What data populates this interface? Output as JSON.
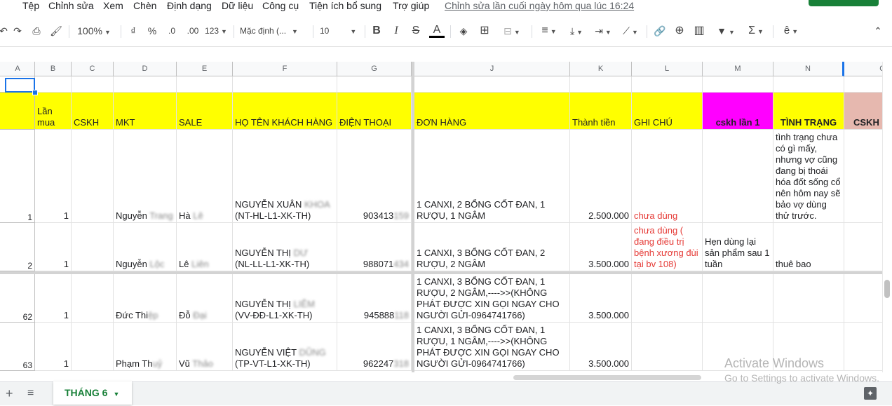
{
  "menu": {
    "items": [
      "Tệp",
      "Chỉnh sửa",
      "Xem",
      "Chèn",
      "Định dạng",
      "Dữ liệu",
      "Công cụ",
      "Tiện ích bổ sung",
      "Trợ giúp"
    ],
    "last_edit": "Chỉnh sửa lần cuối ngày hôm qua lúc 16:24"
  },
  "toolbar": {
    "zoom": "100%",
    "currency": "₫",
    "percent": "%",
    "dec_less": ".0",
    "dec_more": ".00",
    "format_more": "123",
    "font": "Mặc định (...",
    "font_size": "10",
    "bold": "B",
    "italic": "I",
    "strike": "S",
    "text_color": "A"
  },
  "grid": {
    "columns": [
      "A",
      "B",
      "C",
      "D",
      "E",
      "F",
      "G",
      "J",
      "K",
      "L",
      "M",
      "N",
      "O"
    ],
    "header_row": {
      "lan_mua": "Lần mua",
      "cskh": "CSKH",
      "mkt": "MKT",
      "sale": "SALE",
      "ho_ten": "HỌ TÊN KHÁCH HÀNG",
      "dien_thoai": "ĐIỆN THOẠI",
      "don_hang": "ĐƠN HÀNG",
      "thanh_tien": "Thành tiền",
      "ghi_chu": "GHI CHÚ",
      "cskh_lan1": "cskh lần 1",
      "tinh_trang": "TÌNH TRẠNG",
      "cskh2": "CSKH"
    },
    "rows": [
      {
        "a": "1",
        "b": "1",
        "mkt_visible": "Nguyễn",
        "mkt_hidden": "Trang",
        "sale_visible": "Hà",
        "sale_hidden": "Lê",
        "name_visible": "NGUYỄN XUÂN",
        "name_hidden": "KHOA",
        "code": "(NT-HL-L1-XK-TH)",
        "phone_visible": "903413",
        "phone_hidden": "159",
        "order": "1 CANXI, 2 BỔNG CỐT ĐAN, 1\nRƯỢU, 1 NGÂM",
        "amount": "2.500.000",
        "note": "chưa dùng",
        "cskh1": "",
        "status": "tình trạng chưa\ncó gì mấy,\nnhưng vợ cũng\nđang bị thoái\nhóa đốt sống cổ\nnên hôm nay sẽ\nbảo vợ dùng\nthử trước."
      },
      {
        "a": "2",
        "b": "1",
        "mkt_visible": "Nguyễn",
        "mkt_hidden": "Lộc",
        "sale_visible": "Lê",
        "sale_hidden": "Liên",
        "name_visible": "NGUYỄN THỊ",
        "name_hidden": "DƯ",
        "code": "(NL-LL-L1-XK-TH)",
        "phone_visible": "988071",
        "phone_hidden": "434",
        "order": "1 CANXI, 3 BỔNG CỐT ĐAN, 2\nRƯỢU, 2 NGÂM",
        "amount": "3.500.000",
        "note": "chưa dùng (\nđang điều trị\nbệnh xương đùi\ntại bv 108)",
        "cskh1": "Hẹn dùng lại\nsản phẩm sau 1\ntuần",
        "status": "thuê bao"
      },
      {
        "a": "62",
        "b": "1",
        "mkt_visible": "Đức Thi",
        "mkt_hidden": "ệp",
        "sale_visible": "Đỗ",
        "sale_hidden": "Đại",
        "name_visible": "NGUYỄN THỊ",
        "name_hidden": "LIÊM",
        "code": "(VV-ĐĐ-L1-XK-TH)",
        "phone_visible": "945888",
        "phone_hidden": "118",
        "order": "1 CANXI, 3 BỔNG CỐT ĐAN, 1\nRƯỢU, 2 NGÂM,---->>(KHÔNG\nPHÁT ĐƯỢC XIN GỌI NGAY CHO\nNGƯỜI GỬI-0964741766)",
        "amount": "3.500.000",
        "note": "",
        "cskh1": "",
        "status": ""
      },
      {
        "a": "63",
        "b": "1",
        "mkt_visible": "Phạm Th",
        "mkt_hidden": "uỷ",
        "sale_visible": "Vũ",
        "sale_hidden": "Thảo",
        "name_visible": "NGUYỄN VIỆT",
        "name_hidden": "DŨNG",
        "code": "(TP-VT-L1-XK-TH)",
        "phone_visible": "962247",
        "phone_hidden": "318",
        "order": "1 CANXI, 3 BỔNG CỐT ĐAN, 1\nRƯỢU, 1 NGÂM,---->>(KHÔNG\nPHÁT ĐƯỢC XIN GỌI NGAY CHO\nNGƯỜI GỬI-0964741766)",
        "amount": "3.500.000",
        "note": "",
        "cskh1": "",
        "status": ""
      }
    ]
  },
  "sheet": {
    "add": "+",
    "list": "≡",
    "tab_name": "THÁNG 6"
  },
  "watermark": {
    "line1": "Activate Windows",
    "line2": "Go to Settings to activate Windows."
  },
  "colors": {
    "yellow": "#ffff00",
    "magenta": "#ff00ff",
    "pink": "#e6b8af",
    "accent": "#1a73e8",
    "sheet_green": "#188038",
    "red_note": "#e53935"
  }
}
